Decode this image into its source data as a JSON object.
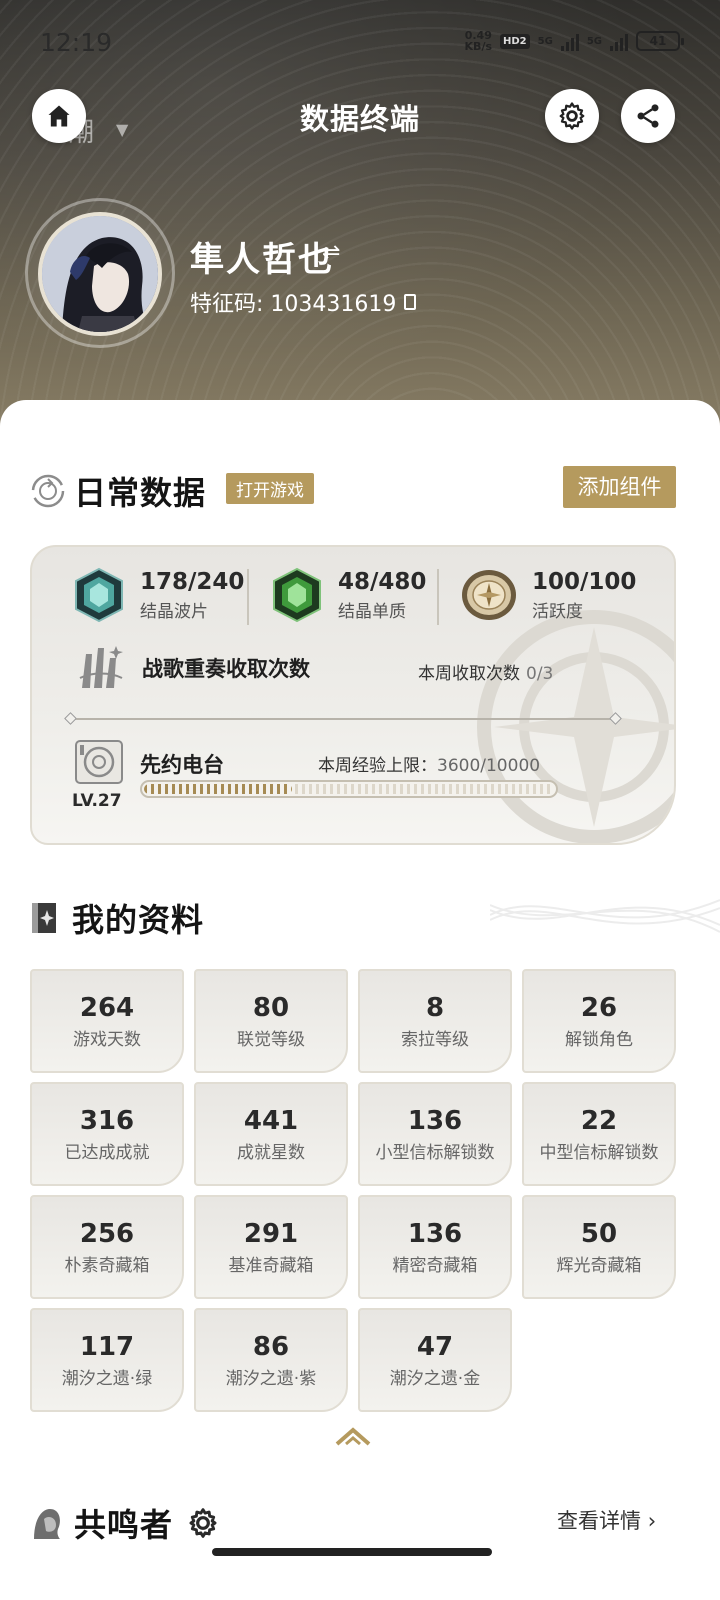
{
  "status_bar": {
    "time": "12:19",
    "net_speed_value": "0.49",
    "net_speed_unit": "KB/s",
    "hd_badge": "HD2",
    "sim1_label": "5G",
    "sim2_label": "5G",
    "battery": "41"
  },
  "header": {
    "title": "数据终端",
    "behind_text": "潮",
    "home_icon": "home-icon",
    "settings_icon": "gear-icon",
    "share_icon": "share-icon"
  },
  "profile": {
    "username": "隼人哲也",
    "swap_symbol": "⇌",
    "uid_label": "特征码: ",
    "uid": "103431619"
  },
  "daily": {
    "title": "日常数据",
    "open_game_label": "打开游戏",
    "add_widget_label": "添加组件",
    "stats": [
      {
        "value": "178/240",
        "label": "结晶波片",
        "icon": "crystal-wave-icon"
      },
      {
        "value": "48/480",
        "label": "结晶单质",
        "icon": "crystal-solvent-icon"
      },
      {
        "value": "100/100",
        "label": "活跃度",
        "icon": "compass-icon"
      }
    ],
    "warsong": {
      "title": "战歌重奏收取次数",
      "weekly_label": "本周收取次数",
      "weekly_count": "0/3"
    },
    "radio": {
      "title": "先约电台",
      "level": "LV.27",
      "exp_label": "本周经验上限：",
      "exp_value": "3600/10000",
      "exp_fraction": 0.36
    }
  },
  "my_profile": {
    "title": "我的资料",
    "tiles": [
      {
        "value": "264",
        "label": "游戏天数"
      },
      {
        "value": "80",
        "label": "联觉等级"
      },
      {
        "value": "8",
        "label": "索拉等级"
      },
      {
        "value": "26",
        "label": "解锁角色"
      },
      {
        "value": "316",
        "label": "已达成成就"
      },
      {
        "value": "441",
        "label": "成就星数"
      },
      {
        "value": "136",
        "label": "小型信标解锁数"
      },
      {
        "value": "22",
        "label": "中型信标解锁数"
      },
      {
        "value": "256",
        "label": "朴素奇藏箱"
      },
      {
        "value": "291",
        "label": "基准奇藏箱"
      },
      {
        "value": "136",
        "label": "精密奇藏箱"
      },
      {
        "value": "50",
        "label": "辉光奇藏箱"
      },
      {
        "value": "117",
        "label": "潮汐之遗·绿"
      },
      {
        "value": "86",
        "label": "潮汐之遗·紫"
      },
      {
        "value": "47",
        "label": "潮汐之遗·金"
      }
    ]
  },
  "resonators": {
    "title": "共鸣者",
    "view_detail_label": "查看详情",
    "view_detail_arrow": "›"
  },
  "colors": {
    "accent_gold": "#b59a5e",
    "text_dark": "#1e1e1e",
    "tile_bg": "#eceae6"
  }
}
